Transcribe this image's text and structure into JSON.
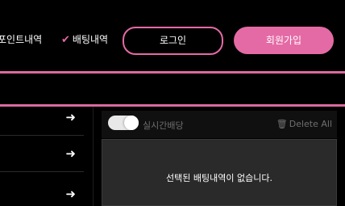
{
  "header": {
    "nav_points": "포인트내역",
    "nav_bet_history": "배팅내역",
    "login_button": "로그인",
    "signup_button": "회원가입"
  },
  "colors": {
    "accent": "#e46aa5",
    "line": "#d96a9f",
    "background": "#000000",
    "panel": "#2a2a2a"
  },
  "left_menu": {
    "items": [
      {
        "icon": "arrow-right-icon"
      },
      {
        "icon": "arrow-right-icon"
      },
      {
        "icon": "arrow-right-icon"
      }
    ]
  },
  "betslip": {
    "toggle_label": "실시간배당",
    "delete_all": "Delete All",
    "empty_message": "선택된 배팅내역이 없습니다."
  }
}
